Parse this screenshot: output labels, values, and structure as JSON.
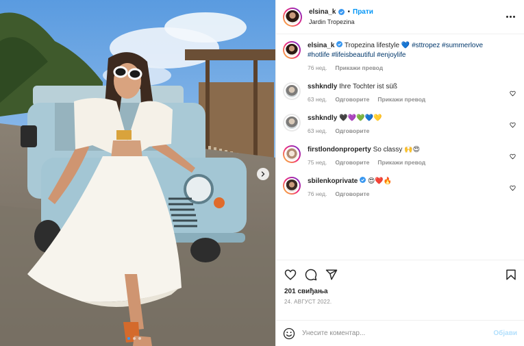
{
  "header": {
    "username": "elsina_k",
    "separator": "•",
    "follow_label": "Прати",
    "location": "Jardin Tropezina",
    "more_icon": "more-horizontal-icon"
  },
  "caption": {
    "username": "elsina_k",
    "text": "Tropezina lifestyle 💙",
    "hashtags": "#sttropez #summerlove #hotlife #lifeisbeautiful #enjoylife",
    "time": "76 нед.",
    "translate_label": "Прикажи превод"
  },
  "comments": [
    {
      "username": "sshkndly",
      "text": "Ihre Tochter ist süß",
      "time": "63 нед.",
      "reply_label": "Одговорите",
      "translate_label": "Прикажи превод"
    },
    {
      "username": "sshkndly",
      "text": "🖤💜💚💙💛",
      "time": "63 нед.",
      "reply_label": "Одговорите"
    },
    {
      "username": "firstlondonproperty",
      "text": "So classy 🙌😍",
      "time": "75 нед.",
      "reply_label": "Одговорите",
      "translate_label": "Прикажи превод"
    },
    {
      "username": "sbilenkoprivate",
      "text": "😍❤️🔥",
      "time": "76 нед.",
      "reply_label": "Одговорите"
    }
  ],
  "actions": {
    "likes": "201 свиђања",
    "date": "24. АВГУСТ 2022."
  },
  "add_comment": {
    "placeholder": "Унесите коментар...",
    "post_label": "Објави"
  },
  "carousel": {
    "total": 3,
    "active": 1
  },
  "colors": {
    "accent": "#0095f6",
    "verified": "#3897f0",
    "muted": "#8e8e8e",
    "hashtag": "#00376b"
  }
}
